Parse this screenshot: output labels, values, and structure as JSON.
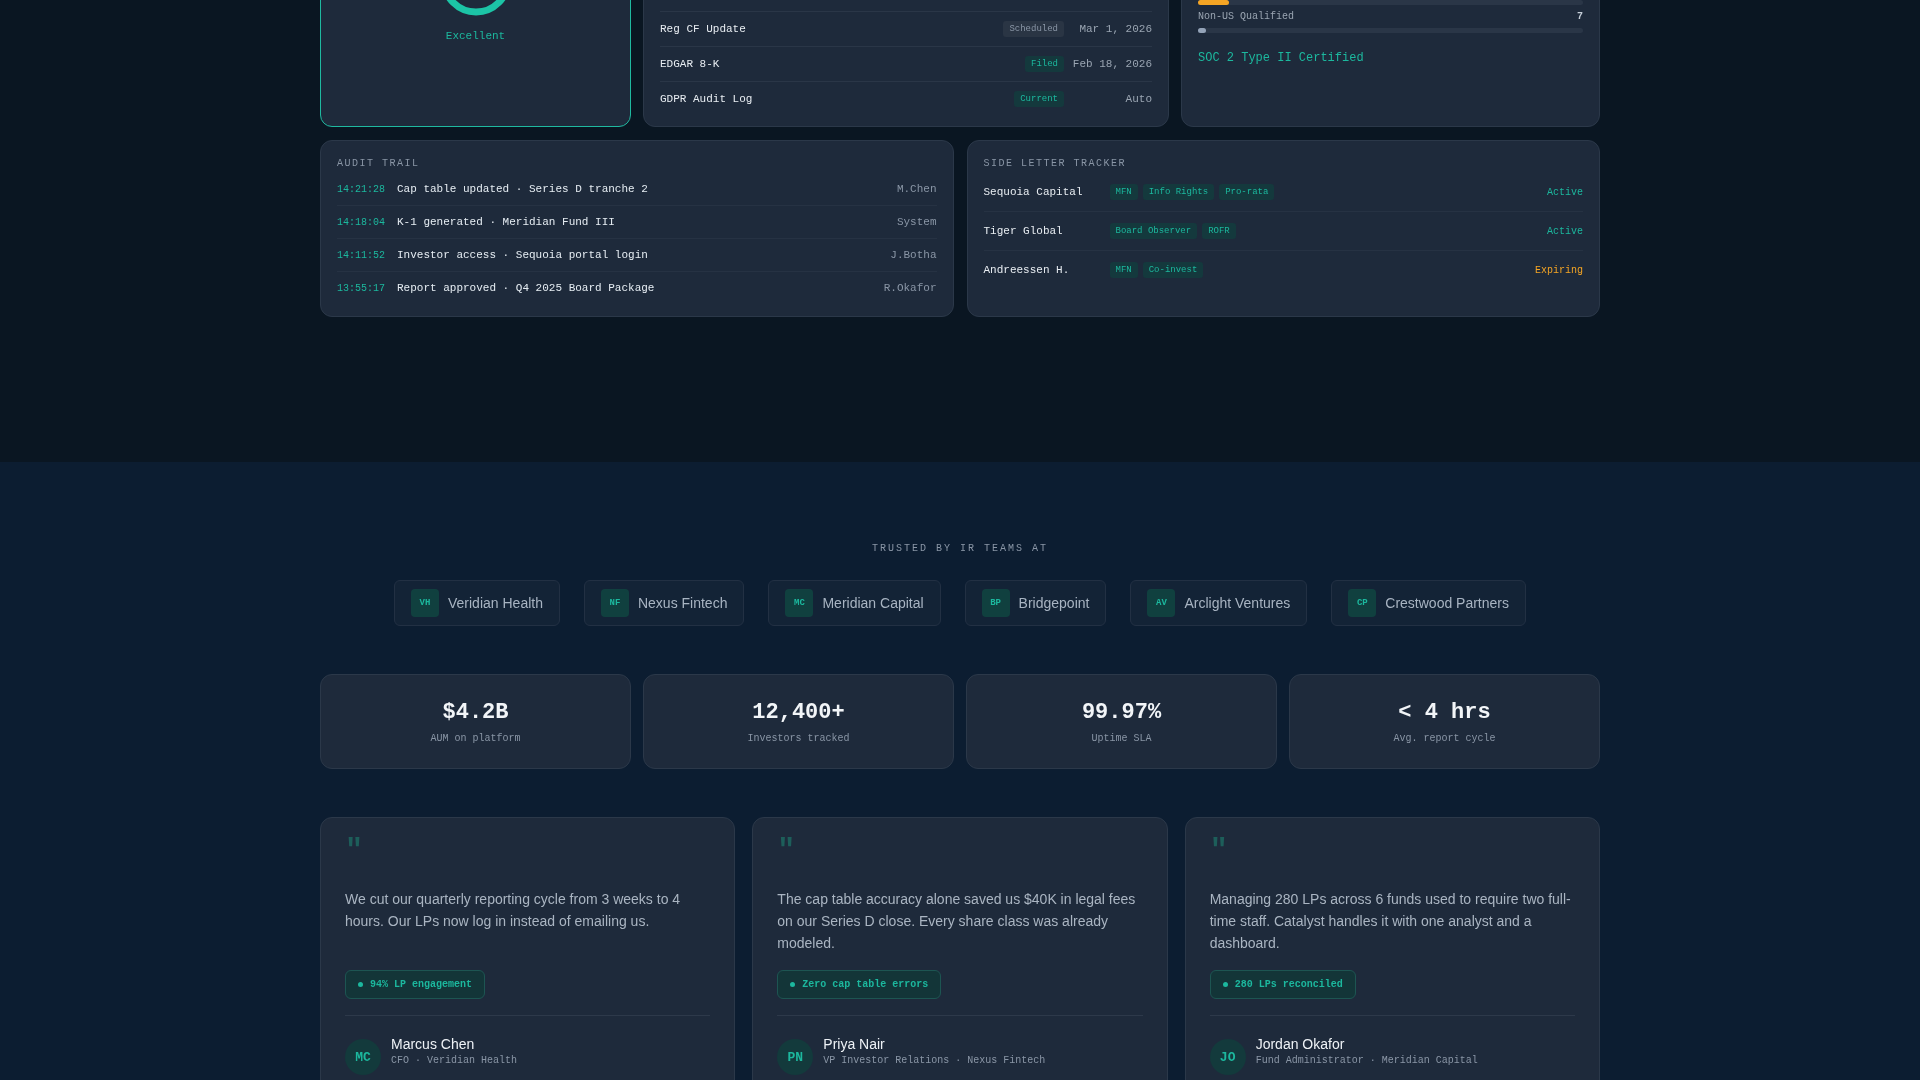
{
  "score_card": {
    "rating": "Excellent"
  },
  "filings": [
    {
      "name": "Reg CF Update",
      "status": "Scheduled",
      "kind": "neutral",
      "date": "Mar 1, 2026"
    },
    {
      "name": "EDGAR 8-K",
      "status": "Filed",
      "kind": "ok",
      "date": "Feb 18, 2026"
    },
    {
      "name": "GDPR Audit Log",
      "status": "Current",
      "kind": "ok",
      "date": "Auto"
    }
  ],
  "investor_bars": [
    {
      "level": 0.08,
      "color": "#f5a524"
    },
    {
      "label": "Non-US Qualified",
      "count": "7",
      "level": 0.01,
      "color": "#94a3b8"
    }
  ],
  "certification": "SOC 2 Type II Certified",
  "audit_trail": {
    "title": "AUDIT TRAIL",
    "rows": [
      {
        "time": "14:21:28",
        "event": "Cap table updated · Series D tranche 2",
        "user": "M.Chen"
      },
      {
        "time": "14:18:04",
        "event": "K-1 generated · Meridian Fund III",
        "user": "System"
      },
      {
        "time": "14:11:52",
        "event": "Investor access · Sequoia portal login",
        "user": "J.Botha"
      },
      {
        "time": "13:55:17",
        "event": "Report approved · Q4 2025 Board Package",
        "user": "R.Okafor"
      }
    ]
  },
  "side_letters": {
    "title": "SIDE LETTER TRACKER",
    "rows": [
      {
        "investor": "Sequoia Capital",
        "terms": [
          "MFN",
          "Info Rights",
          "Pro-rata"
        ],
        "status": "Active",
        "kind": "active"
      },
      {
        "investor": "Tiger Global",
        "terms": [
          "Board Observer",
          "ROFR"
        ],
        "status": "Active",
        "kind": "active"
      },
      {
        "investor": "Andreessen H.",
        "terms": [
          "MFN",
          "Co-invest"
        ],
        "status": "Expiring",
        "kind": "expiring"
      }
    ]
  },
  "trusted_label": "TRUSTED BY IR TEAMS AT",
  "logos": [
    {
      "initials": "VH",
      "name": "Veridian Health"
    },
    {
      "initials": "NF",
      "name": "Nexus Fintech"
    },
    {
      "initials": "MC",
      "name": "Meridian Capital"
    },
    {
      "initials": "BP",
      "name": "Bridgepoint"
    },
    {
      "initials": "AV",
      "name": "Arclight Ventures"
    },
    {
      "initials": "CP",
      "name": "Crestwood Partners"
    }
  ],
  "stats": [
    {
      "value": "$4.2B",
      "label": "AUM on platform"
    },
    {
      "value": "12,400+",
      "label": "Investors tracked"
    },
    {
      "value": "99.97%",
      "label": "Uptime SLA"
    },
    {
      "value": "< 4 hrs",
      "label": "Avg. report cycle"
    }
  ],
  "testimonials": [
    {
      "mark": "\"",
      "quote": "We cut our quarterly reporting cycle from 3 weeks to 4 hours. Our LPs now log in instead of emailing us.",
      "metric": "94% LP engagement",
      "initials": "MC",
      "name": "Marcus Chen",
      "role": "CFO · Veridian Health"
    },
    {
      "mark": "\"",
      "quote": "The cap table accuracy alone saved us $40K in legal fees on our Series D close. Every share class was already modeled.",
      "metric": "Zero cap table errors",
      "initials": "PN",
      "name": "Priya Nair",
      "role": "VP Investor Relations · Nexus Fintech"
    },
    {
      "mark": "\"",
      "quote": "Managing 280 LPs across 6 funds used to require two full-time staff. Catalyst handles it with one analyst and a dashboard.",
      "metric": "280 LPs reconciled",
      "initials": "JO",
      "name": "Jordan Okafor",
      "role": "Fund Administrator · Meridian Capital"
    }
  ]
}
